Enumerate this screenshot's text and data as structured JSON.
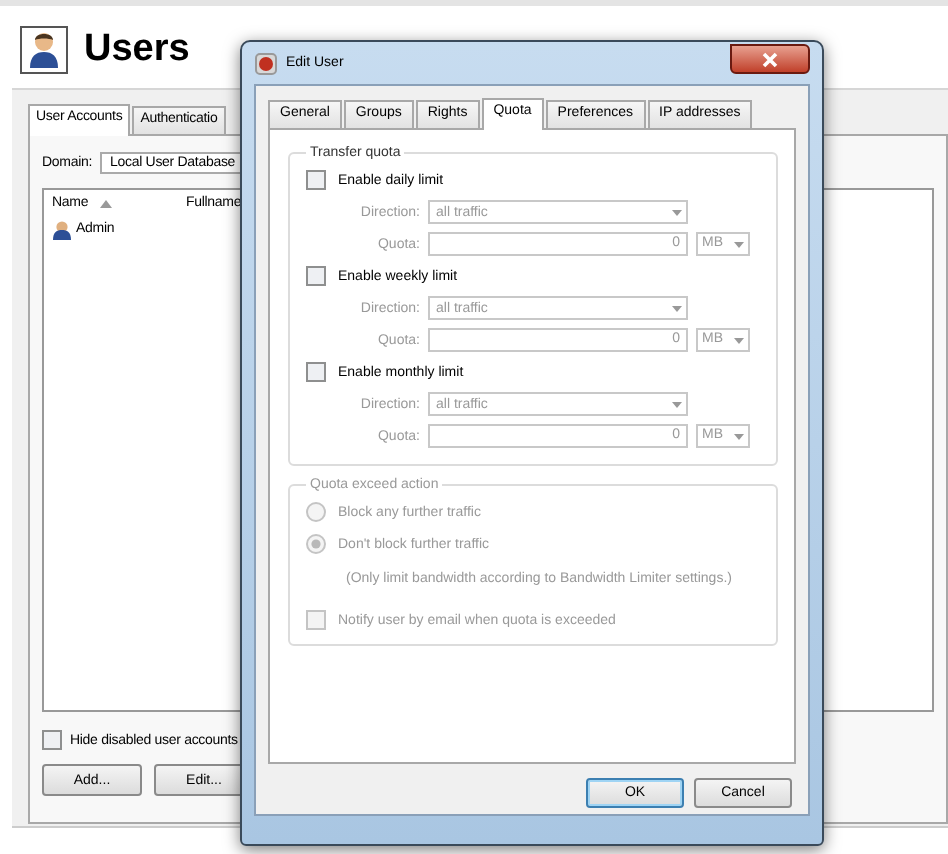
{
  "header": {
    "title": "Users"
  },
  "main": {
    "tabs": [
      {
        "label": "User Accounts",
        "selected": true
      },
      {
        "label": "Authenticatio",
        "selected": false
      }
    ],
    "domain": {
      "label": "Domain:",
      "value": "Local User Database"
    },
    "columns": [
      {
        "label": "Name",
        "sorted": true
      },
      {
        "label": "Fullname"
      }
    ],
    "rows": [
      {
        "name": "Admin"
      }
    ],
    "hide_disabled": {
      "label": "Hide disabled user accounts",
      "checked": false
    },
    "buttons": [
      "Add...",
      "Edit..."
    ]
  },
  "dialog": {
    "title": "Edit User",
    "tabs": [
      {
        "label": "General",
        "selected": false
      },
      {
        "label": "Groups",
        "selected": false
      },
      {
        "label": "Rights",
        "selected": false
      },
      {
        "label": "Quota",
        "selected": true
      },
      {
        "label": "Preferences",
        "selected": false
      },
      {
        "label": "IP addresses",
        "selected": false
      }
    ],
    "transfer_quota": {
      "title": "Transfer quota",
      "limits": [
        {
          "label": "Enable daily limit",
          "checked": false,
          "direction_label": "Direction:",
          "direction": "all traffic",
          "quota_label": "Quota:",
          "quota": "0",
          "unit": "MB"
        },
        {
          "label": "Enable weekly limit",
          "checked": false,
          "direction_label": "Direction:",
          "direction": "all traffic",
          "quota_label": "Quota:",
          "quota": "0",
          "unit": "MB"
        },
        {
          "label": "Enable monthly limit",
          "checked": false,
          "direction_label": "Direction:",
          "direction": "all traffic",
          "quota_label": "Quota:",
          "quota": "0",
          "unit": "MB"
        }
      ]
    },
    "exceed": {
      "title": "Quota exceed action",
      "disabled": true,
      "options": [
        {
          "label": "Block any further traffic",
          "selected": false
        },
        {
          "label": "Don't block further traffic",
          "selected": true
        }
      ],
      "note": "(Only limit bandwidth according to Bandwidth Limiter settings.)",
      "notify": {
        "label": "Notify user by email when quota is exceeded",
        "checked": false
      }
    },
    "buttons": [
      {
        "label": "OK",
        "default": true
      },
      {
        "label": "Cancel",
        "default": false
      }
    ]
  }
}
